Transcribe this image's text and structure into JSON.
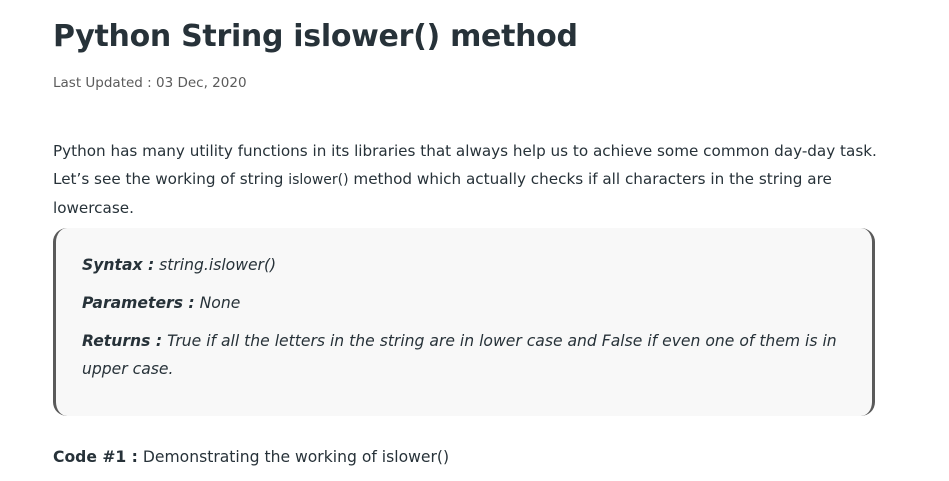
{
  "article": {
    "title": "Python String islower() method",
    "last_updated": "Last Updated : 03 Dec, 2020",
    "intro": {
      "part1": "Python has many utility functions in its libraries that always help us to achieve some common day-day task. Let’s see the working of string ",
      "code": "islower()",
      "part2": " method which actually checks if all characters in the string are lowercase."
    },
    "blockquote": {
      "syntax_label": "Syntax :",
      "syntax_value": " string.islower()",
      "parameters_label": "Parameters :",
      "parameters_value": " None",
      "returns_label": "Returns :",
      "returns_value": " True if all the letters in the string are in lower case and False if even one of them is in upper case."
    },
    "code_heading": {
      "label": "Code #1 :",
      "text": " Demonstrating the working of islower()"
    }
  }
}
